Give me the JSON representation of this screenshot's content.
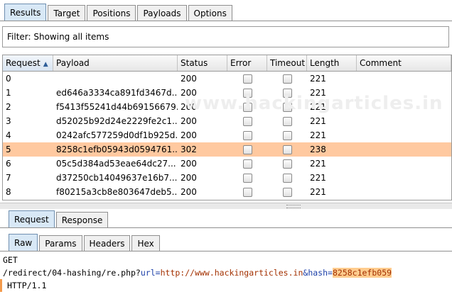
{
  "top_tabs": [
    "Results",
    "Target",
    "Positions",
    "Payloads",
    "Options"
  ],
  "filter_text": "Filter: Showing all items",
  "table": {
    "columns": [
      "Request",
      "Payload",
      "Status",
      "Error",
      "Timeout",
      "Length",
      "Comment"
    ],
    "rows": [
      {
        "request": "0",
        "payload": "",
        "status": "200",
        "length": "221"
      },
      {
        "request": "1",
        "payload": "ed646a3334ca891fd3467d...",
        "status": "200",
        "length": "221"
      },
      {
        "request": "2",
        "payload": "f5413f55241d44b69156679...",
        "status": "200",
        "length": "221"
      },
      {
        "request": "3",
        "payload": "d52025b92d24e2229fe2c1...",
        "status": "200",
        "length": "221"
      },
      {
        "request": "4",
        "payload": "0242afc577259d0df1b925d...",
        "status": "200",
        "length": "221"
      },
      {
        "request": "5",
        "payload": "8258c1efb05943d0594761...",
        "status": "302",
        "length": "238"
      },
      {
        "request": "6",
        "payload": "05c5d384ad53eae64dc27...",
        "status": "200",
        "length": "221"
      },
      {
        "request": "7",
        "payload": "d37250cb14049637e16b7...",
        "status": "200",
        "length": "221"
      },
      {
        "request": "8",
        "payload": "f80215a3cb8e803647deb5...",
        "status": "200",
        "length": "221"
      }
    ]
  },
  "watermark": "www.hackingarticles.in",
  "reqres_tabs": [
    "Request",
    "Response"
  ],
  "inner_tabs": [
    "Raw",
    "Params",
    "Headers",
    "Hex"
  ],
  "raw": {
    "method": "GET",
    "path": "/redirect/04-hashing/re.php?",
    "param1": "url",
    "eq1": "=",
    "value1": "http://www.hackingarticles.in",
    "amp": "&",
    "param2": "hash",
    "eq2": "=",
    "value2": "8258c1efb059",
    "version": "HTTP/1.1"
  }
}
